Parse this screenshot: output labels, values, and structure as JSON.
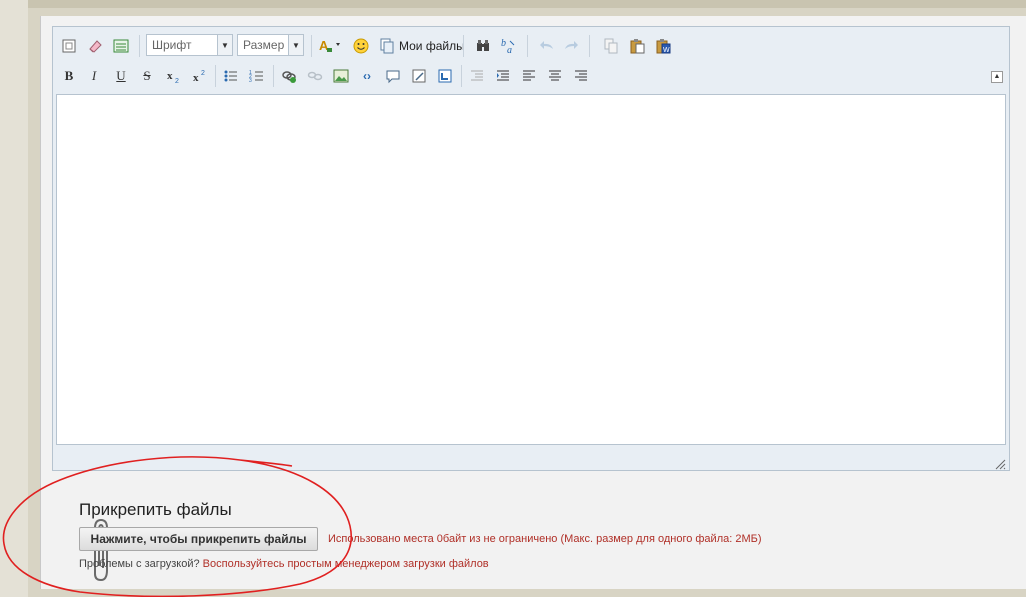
{
  "toolbar": {
    "font_label": "Шрифт",
    "size_label": "Размер",
    "my_files_label": "Мои файлы"
  },
  "attach": {
    "title": "Прикрепить файлы",
    "button_label": "Нажмите, чтобы прикрепить файлы",
    "space_info": "Использовано места 0байт из не ограничено (Макс. размер для одного файла: 2МБ)",
    "problems_text": "Проблемы с загрузкой? ",
    "problems_link": "Воспользуйтесь простым менеджером загрузки файлов"
  },
  "icons": {
    "row1": [
      "source-icon",
      "eraser-icon",
      "toggle-view-icon",
      "text-color-icon",
      "emoticon-icon",
      "my-files-icon",
      "find-icon",
      "replace-icon",
      "undo-icon",
      "redo-icon",
      "copy-icon",
      "paste-icon",
      "paste-word-icon"
    ],
    "row2": [
      "bold-icon",
      "italic-icon",
      "underline-icon",
      "strikethrough-icon",
      "subscript-icon",
      "superscript-icon",
      "bulleted-list-icon",
      "numbered-list-icon",
      "link-icon",
      "unlink-icon",
      "image-icon",
      "code-icon",
      "quote-icon",
      "spoiler-icon",
      "media-icon",
      "outdent-icon",
      "indent-icon",
      "align-left-icon",
      "align-center-icon",
      "align-right-icon"
    ]
  },
  "colors": {
    "accent": "#b03028",
    "annotation": "#e02020"
  }
}
